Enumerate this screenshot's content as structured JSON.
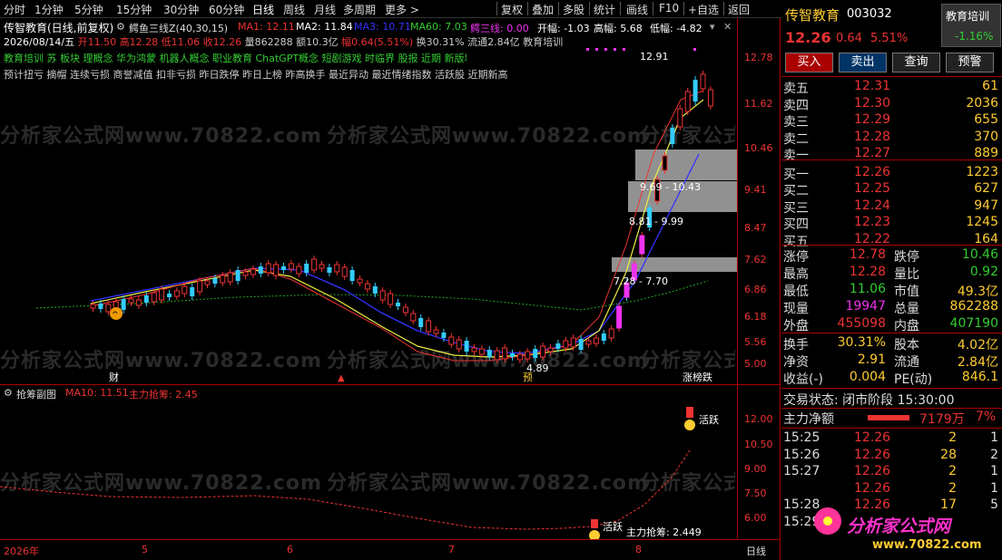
{
  "toolbar": {
    "items": [
      "分时",
      "1分钟",
      "5分钟",
      "15分钟",
      "30分钟",
      "60分钟",
      "日线",
      "周线",
      "月线",
      "多周期",
      "更多 >"
    ],
    "right_items": [
      "复权",
      "叠加",
      "多股",
      "统计",
      "画线",
      "F10",
      "+自选",
      "返回"
    ]
  },
  "header": {
    "stock_title": "传智教育(日线,前复权)",
    "indicator": "鳄鱼三线Z(40,30,15)",
    "ma1": "MA1: 12.11",
    "ma2": "MA2: 11.84",
    "ma3": "MA3: 10.71",
    "ma60": "MA60: 7.03",
    "eyu": "鳄三线: 0.00",
    "kaifu": "开幅: -1.03",
    "gaofu": "高幅: 5.68",
    "difu": "低幅: -4.82",
    "ohlc_date": "2026/08/14/五",
    "ohlc_open": "开11.50",
    "ohlc_high": "高12.28",
    "ohlc_low": "低11.06",
    "ohlc_close": "收12.26",
    "ohlc_vol": "量862288",
    "ohlc_amt": "额10.3亿",
    "ohlc_chg": "幅0.64(5.51%)",
    "ohlc_turn": "换30.31%",
    "ohlc_float": "流通2.84亿",
    "ohlc_tag": "教育培训",
    "concepts1": "教育培训 苏 板块 理概念 华为鸿蒙 机器人概念 职业教育 ChatGPT概念 短剧游戏 时临界 股报 近期 新版块 N",
    "concepts2": "预计扭亏 摘帽 连续亏损 商誉减值 扣非亏损 昨日跌停 昨日上榜 昨高换手 最近异动 最近情绪指数 活跃股 近期新高"
  },
  "main_chart": {
    "yaxis": [
      "12.78",
      "11.62",
      "10.46",
      "9.41",
      "8.47",
      "7.62",
      "6.86",
      "6.18",
      "5.56",
      "5.00"
    ],
    "annotations": {
      "high": "12.91",
      "low": "4.89",
      "gap1": "9.69 - 10.43",
      "gap2": "8.81 - 9.99",
      "gap3": "7.28 - 7.70",
      "cai": "财",
      "yu": "预",
      "zdt": "涨榜跌"
    }
  },
  "sub_chart": {
    "title": "抢筹副图",
    "ma10": "MA10: 11.51",
    "zhuli": "主力抢筹: 2.45",
    "yaxis": [
      "12.00",
      "10.50",
      "9.00",
      "7.50",
      "6.00"
    ],
    "label_active1": "活跃",
    "label_active2": "活跃",
    "end_label": "主力抢筹: 2.449"
  },
  "xaxis": {
    "labels": [
      "2026年",
      "5",
      "6",
      "7",
      "8"
    ],
    "period": "日线"
  },
  "watermark": "分析家公式网www.70822.com",
  "right": {
    "name": "传智教育",
    "code": "003032",
    "sector": "教育培训",
    "sector_chg": "-1.16%",
    "price": "12.26",
    "chg": "0.64",
    "pct": "5.51%",
    "buttons": [
      "买入",
      "卖出",
      "查询",
      "预警"
    ],
    "asks": [
      {
        "l": "卖五",
        "p": "12.31",
        "v": "61"
      },
      {
        "l": "卖四",
        "p": "12.30",
        "v": "2036"
      },
      {
        "l": "卖三",
        "p": "12.29",
        "v": "655"
      },
      {
        "l": "卖二",
        "p": "12.28",
        "v": "370"
      },
      {
        "l": "卖一",
        "p": "12.27",
        "v": "889"
      }
    ],
    "bids": [
      {
        "l": "买一",
        "p": "12.26",
        "v": "1223"
      },
      {
        "l": "买二",
        "p": "12.25",
        "v": "627"
      },
      {
        "l": "买三",
        "p": "12.24",
        "v": "947"
      },
      {
        "l": "买四",
        "p": "12.23",
        "v": "1245"
      },
      {
        "l": "买五",
        "p": "12.22",
        "v": "164"
      }
    ],
    "stats": [
      [
        "涨停",
        "12.78",
        "跌停",
        "10.46"
      ],
      [
        "最高",
        "12.28",
        "量比",
        "0.92"
      ],
      [
        "最低",
        "11.06",
        "市值",
        "49.3亿"
      ],
      [
        "现量",
        "19947",
        "总量",
        "862288"
      ],
      [
        "外盘",
        "455098",
        "内盘",
        "407190"
      ]
    ],
    "stats2": [
      [
        "换手",
        "30.31%",
        "股本",
        "4.02亿"
      ],
      [
        "净资",
        "2.91",
        "流通",
        "2.84亿"
      ],
      [
        "收益(-)",
        "0.004",
        "PE(动)",
        "846.1"
      ]
    ],
    "trade_state": "交易状态: 闭市阶段 15:30:00",
    "net_label": "主力净额",
    "net_val": "7179万",
    "net_pct": "7%",
    "ticks": [
      [
        "15:25",
        "12.26",
        "2",
        "1"
      ],
      [
        "15:26",
        "12.26",
        "28",
        "2"
      ],
      [
        "15:27",
        "12.26",
        "2",
        "1"
      ],
      [
        "",
        "12.26",
        "2",
        "1"
      ],
      [
        "15:28",
        "12.26",
        "17",
        "5"
      ],
      [
        "15:29",
        "",
        "",
        ""
      ]
    ],
    "logo_text": "分析家公式网",
    "logo_url": "www.70822.com"
  }
}
